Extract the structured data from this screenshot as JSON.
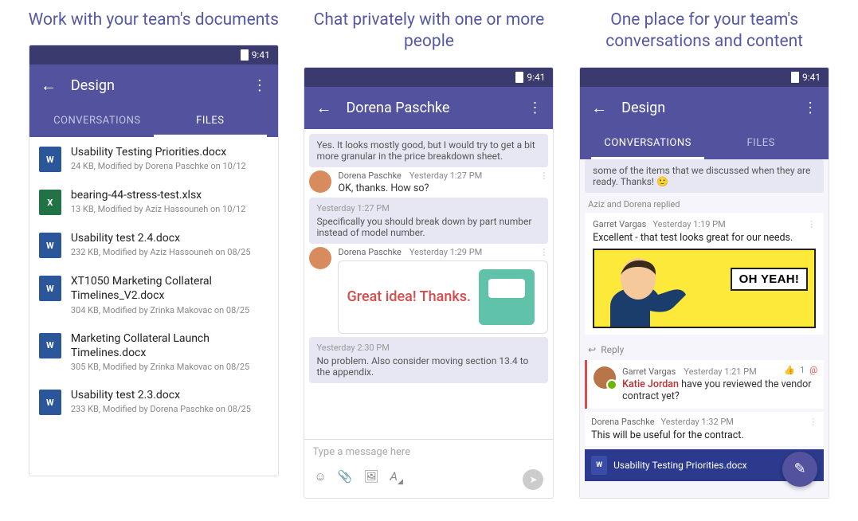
{
  "status_time": "9:41",
  "captions": {
    "files": "Work with your team's documents",
    "chat": "Chat privately with one or more people",
    "conv": "One place for your team's conversations and content"
  },
  "screen1": {
    "title": "Design",
    "tabs": {
      "conversations": "CONVERSATIONS",
      "files": "FILES"
    },
    "files": [
      {
        "icon": "word",
        "name": "Usability Testing Priorities.docx",
        "meta": "24 KB, Modified by Dorena Paschke on 10/12"
      },
      {
        "icon": "excel",
        "name": "bearing-44-stress-test.xlsx",
        "meta": "13 KB, Modified by Aziz Hassouneh on 10/12"
      },
      {
        "icon": "word",
        "name": "Usability test 2.4.docx",
        "meta": "232 KB, Modified by Aziz Hassouneh on 08/25"
      },
      {
        "icon": "word",
        "name": "XT1050 Marketing Collateral Timelines_V2.docx",
        "meta": "304 KB, Modified by Zrinka Makovac on 08/25"
      },
      {
        "icon": "word",
        "name": "Marketing Collateral Launch Timelines.docx",
        "meta": "305 KB, Modified by Zrinka Makovac on 08/25"
      },
      {
        "icon": "word",
        "name": "Usability test 2.3.docx",
        "meta": "233 KB, Modified by Dorena Paschke on 08/25"
      }
    ]
  },
  "screen2": {
    "title": "Dorena Paschke",
    "top_bubble": "Yes. It looks mostly good, but I would try to get a bit more granular in the price breakdown sheet.",
    "msg1": {
      "name": "Dorena Paschke",
      "time": "Yesterday 1:27 PM",
      "text": "OK, thanks. How so?"
    },
    "bubble2": {
      "time": "Yesterday 1:27 PM",
      "text": "Specifically you should break down by part number instead of model number."
    },
    "msg2": {
      "name": "Dorena Paschke",
      "time": "Yesterday 1:29 PM"
    },
    "sticker_text": "Great idea! Thanks.",
    "bubble3": {
      "time": "Yesterday 2:30 PM",
      "text": "No problem. Also consider moving section 13.4 to the appendix."
    },
    "composer_placeholder": "Type a message here"
  },
  "screen3": {
    "title": "Design",
    "tabs": {
      "conversations": "CONVERSATIONS",
      "files": "FILES"
    },
    "top_bubble": "some of the items that we discussed when they are ready. Thanks! 🙂",
    "replied": "Aziz and Dorena replied",
    "post1": {
      "name": "Garret Vargas",
      "time": "Yesterday 1:19 PM",
      "text": "Excellent - that test looks great for our needs."
    },
    "meme_text": "OH YEAH!",
    "reply_label": "Reply",
    "thread1": {
      "name": "Garret Vargas",
      "time": "Yesterday 1:21 PM",
      "like": "1",
      "mention": "Katie Jordan",
      "text": " have you reviewed the vendor contract yet?"
    },
    "thread2": {
      "name": "Dorena Paschke",
      "time": "Yesterday 1:32 PM",
      "text": "This will be useful for the contract."
    },
    "attachment": "Usability Testing Priorities.docx"
  }
}
